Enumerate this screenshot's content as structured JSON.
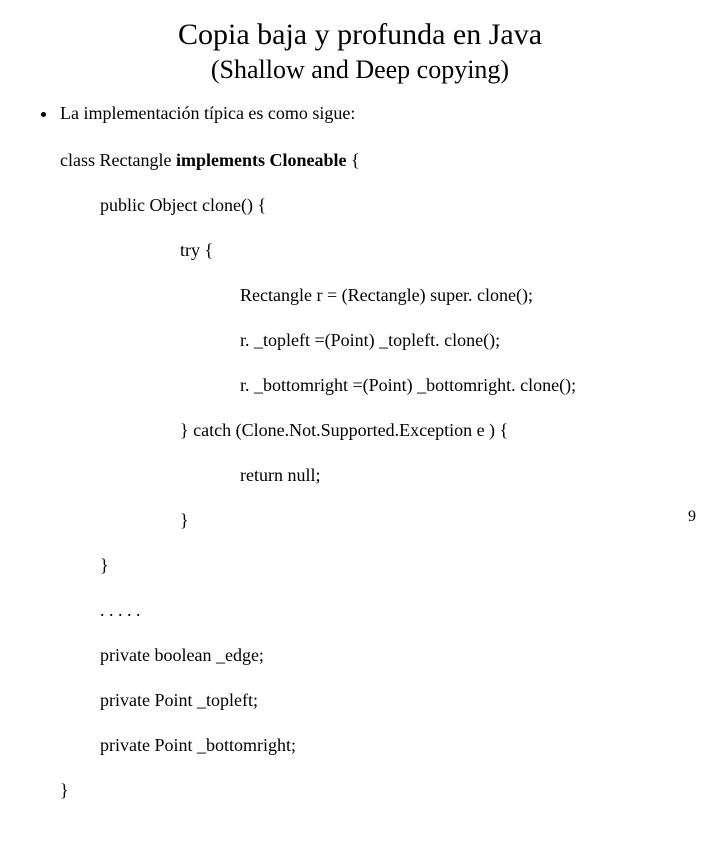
{
  "title": "Copia baja y profunda en Java",
  "subtitle": "(Shallow and Deep copying)",
  "bullet": "La implementación típica es como sigue:",
  "code": {
    "l01a": "class Rectangle ",
    "l01b": "implements Cloneable",
    "l01c": " {",
    "l02": "public Object clone() {",
    "l03": "try {",
    "l04": "Rectangle r = (Rectangle) super. clone();",
    "l05": "r. _topleft =(Point) _topleft. clone();",
    "l06": "r. _bottomright =(Point) _bottomright. clone();",
    "l07": "} catch (Clone.Not.Supported.Exception e ) {",
    "l08": "return null;",
    "l09": "}",
    "l10": "}",
    "l11": ". . . . .",
    "l12": "private boolean _edge;",
    "l13": "private Point _topleft;",
    "l14": "private Point _bottomright;",
    "l15": "}"
  },
  "pagenum": "9"
}
